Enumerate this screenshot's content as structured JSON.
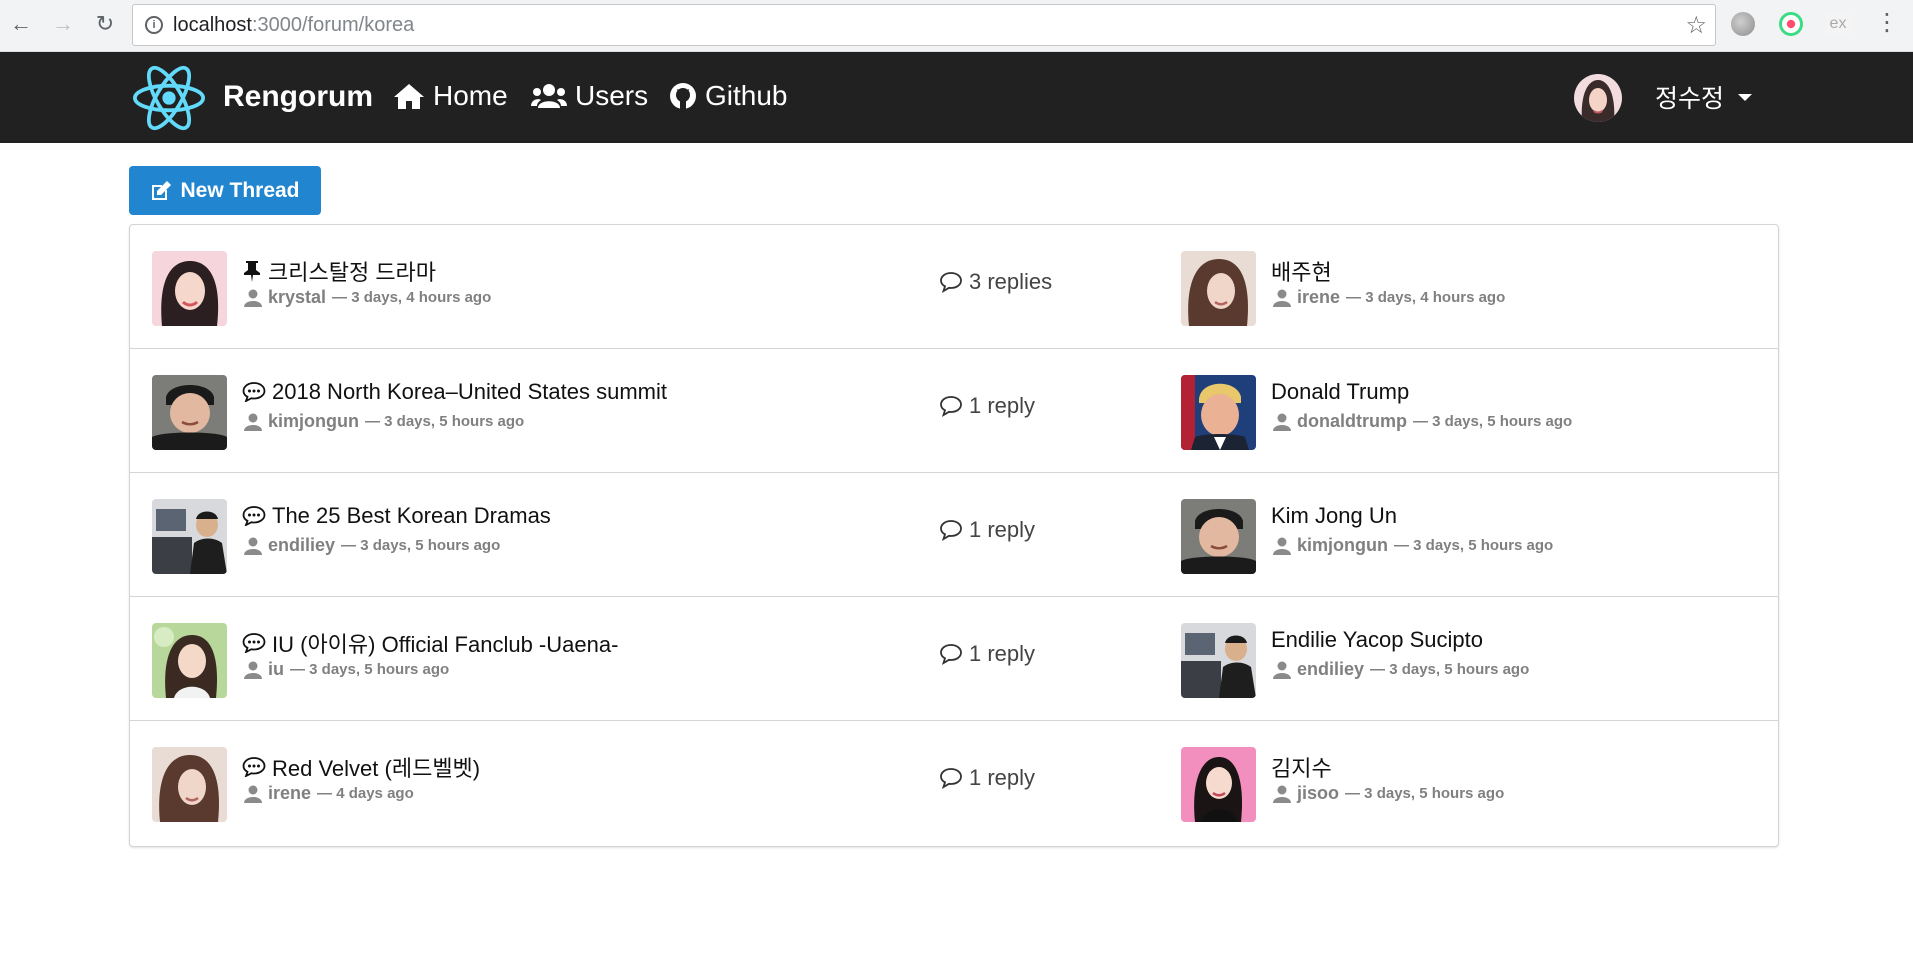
{
  "browser": {
    "url_host": "localhost",
    "url_rest": ":3000/forum/korea"
  },
  "navbar": {
    "brand": "Rengorum",
    "links": [
      {
        "label": "Home",
        "icon": "home-icon"
      },
      {
        "label": "Users",
        "icon": "users-icon"
      },
      {
        "label": "Github",
        "icon": "github-icon"
      }
    ],
    "username": "정수정"
  },
  "new_thread_label": "New Thread",
  "threads": [
    {
      "icon": "pin-icon",
      "title": "크리스탈정 드라마",
      "author": "krystal",
      "time": "— 3 days, 4 hours ago",
      "replies": "3 replies",
      "last_title": "배주현",
      "last_author": "irene",
      "last_time": "— 3 days, 4 hours ago"
    },
    {
      "icon": "comments-icon",
      "title": "2018 North Korea–United States summit",
      "author": "kimjongun",
      "time": "— 3 days, 5 hours ago",
      "replies": "1 reply",
      "last_title": "Donald Trump",
      "last_author": "donaldtrump",
      "last_time": "— 3 days, 5 hours ago"
    },
    {
      "icon": "comments-icon",
      "title": "The 25 Best Korean Dramas",
      "author": "endiliey",
      "time": "— 3 days, 5 hours ago",
      "replies": "1 reply",
      "last_title": "Kim Jong Un",
      "last_author": "kimjongun",
      "last_time": "— 3 days, 5 hours ago"
    },
    {
      "icon": "comments-icon",
      "title": "IU (아이유) Official Fanclub -Uaena-",
      "author": "iu",
      "time": "— 3 days, 5 hours ago",
      "replies": "1 reply",
      "last_title": "Endilie Yacop Sucipto",
      "last_author": "endiliey",
      "last_time": "— 3 days, 5 hours ago"
    },
    {
      "icon": "comments-icon",
      "title": "Red Velvet (레드벨벳)",
      "author": "irene",
      "time": "— 4 days ago",
      "replies": "1 reply",
      "last_title": "김지수",
      "last_author": "jisoo",
      "last_time": "— 3 days, 5 hours ago"
    }
  ]
}
